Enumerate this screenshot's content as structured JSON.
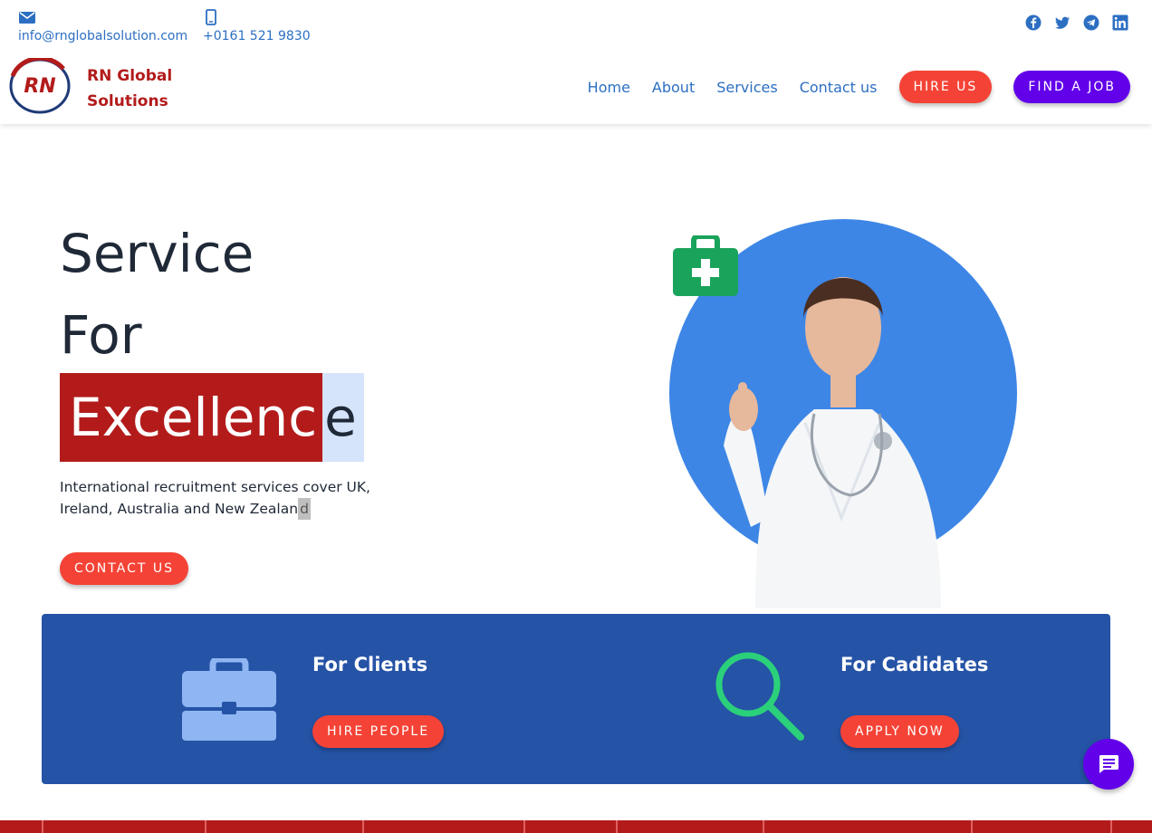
{
  "header": {
    "email": "info@rnglobalsolution.com",
    "phone": "+0161 521 9830",
    "brand_line1": "RN Global",
    "brand_line2": "Solutions",
    "logo_text": "RN",
    "nav": [
      "Home",
      "About",
      "Services",
      "Contact us"
    ],
    "hire_us": "HIRE US",
    "find_job": "FIND A JOB",
    "social_icons": [
      "facebook-icon",
      "twitter-icon",
      "telegram-icon",
      "linkedin-icon"
    ]
  },
  "hero": {
    "line1": "Service",
    "line2": "For",
    "line3_highlight": "Excellenc",
    "line3_selected": "e",
    "description": "International recruitment services cover UK, Ireland, Australia and New Zealan",
    "caret_char": "d",
    "contact_button": "CONTACT US"
  },
  "band": {
    "clients_title": "For Clients",
    "clients_button": "HIRE PEOPLE",
    "candidates_title": "For Cadidates",
    "candidates_button": "APPLY NOW"
  },
  "colors": {
    "brand_red": "#b31b1b",
    "link_blue": "#2c6fc2",
    "accent_red": "#f44336",
    "accent_purple": "#6200ea",
    "band_blue": "#2553a6",
    "medkit_green": "#1aa35a",
    "search_green": "#2bd07a"
  }
}
